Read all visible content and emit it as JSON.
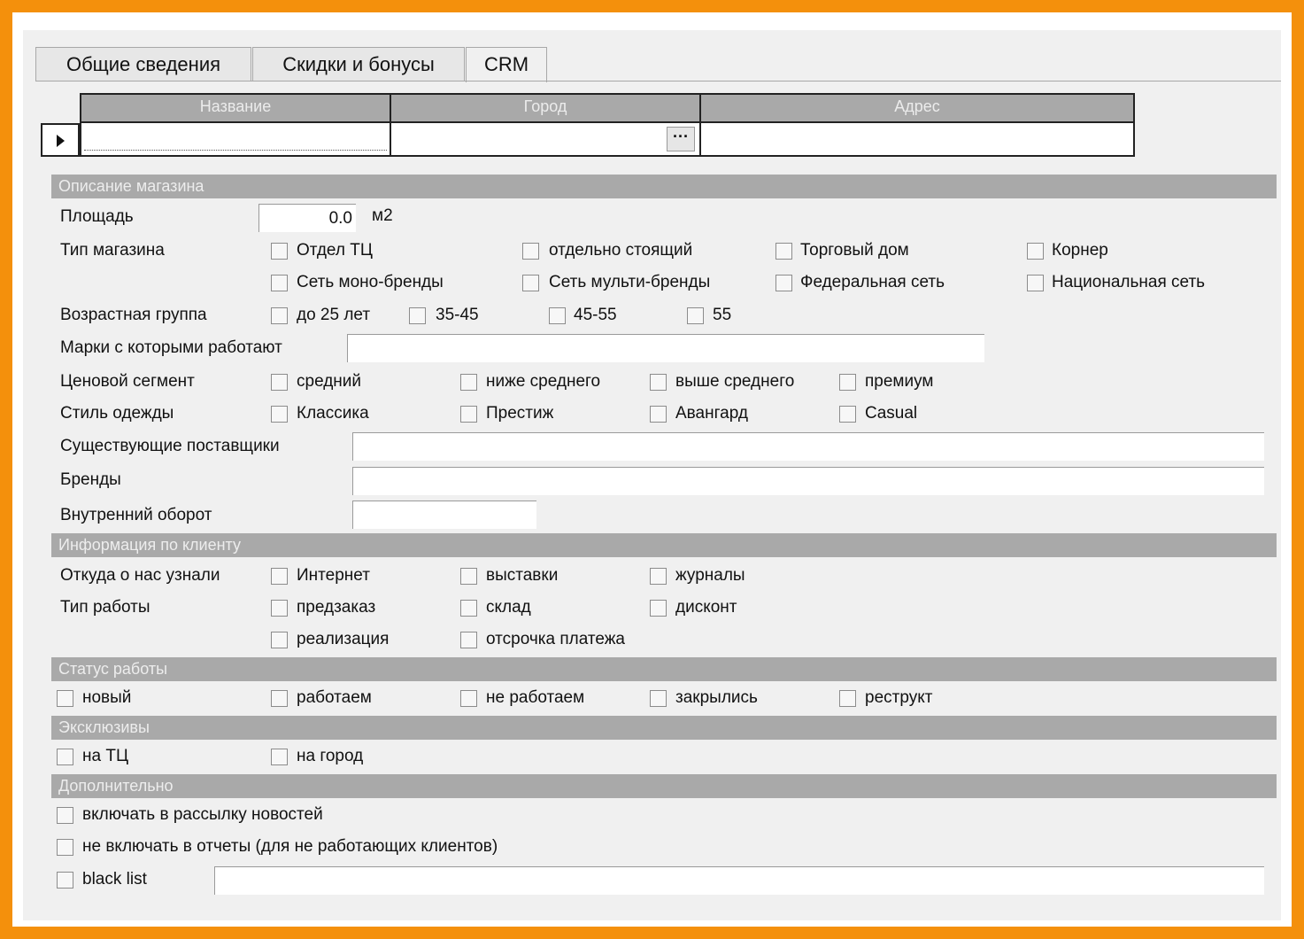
{
  "tabs": [
    {
      "label": "Общие сведения"
    },
    {
      "label": "Скидки и бонусы"
    },
    {
      "label": "CRM"
    }
  ],
  "grid": {
    "columns": [
      "Название",
      "Город",
      "Адрес"
    ],
    "ellipsis": "···"
  },
  "sections": {
    "store": "Описание магазина",
    "client": "Информация по клиенту",
    "status": "Статус работы",
    "exclusive": "Эксклюзивы",
    "extra": "Дополнительно"
  },
  "store": {
    "area_label": "Площадь",
    "area_value": "0.0",
    "area_unit": "м2",
    "type_label": "Тип магазина",
    "type_options": [
      "Отдел ТЦ",
      "отдельно стоящий",
      "Торговый дом",
      "Корнер",
      "Сеть моно-бренды",
      "Сеть мульти-бренды",
      "Федеральная сеть",
      "Национальная сеть"
    ],
    "age_label": "Возрастная группа",
    "age_options": [
      "до 25 лет",
      "35-45",
      "45-55",
      "55"
    ],
    "brands_worked_label": "Марки с которыми работают",
    "price_label": "Ценовой сегмент",
    "price_options": [
      "средний",
      "ниже среднего",
      "выше среднего",
      "премиум"
    ],
    "style_label": "Стиль одежды",
    "style_options": [
      "Классика",
      "Престиж",
      "Авангард",
      "Casual"
    ],
    "suppliers_label": "Существующие поставщики",
    "brands_label": "Бренды",
    "turnover_label": "Внутренний оборот"
  },
  "client": {
    "source_label": "Откуда о нас узнали",
    "source_options": [
      "Интернет",
      "выставки",
      "журналы"
    ],
    "work_type_label": "Тип работы",
    "work_type_options": [
      "предзаказ",
      "склад",
      "дисконт",
      "реализация",
      "отсрочка платежа"
    ]
  },
  "status": {
    "options": [
      "новый",
      "работаем",
      "не работаем",
      "закрылись",
      "реструкт"
    ]
  },
  "exclusive": {
    "options": [
      "на ТЦ",
      "на город"
    ]
  },
  "extra": {
    "options": [
      "включать в рассылку новостей",
      "не включать в отчеты (для не работающих клиентов)",
      "black list"
    ]
  }
}
